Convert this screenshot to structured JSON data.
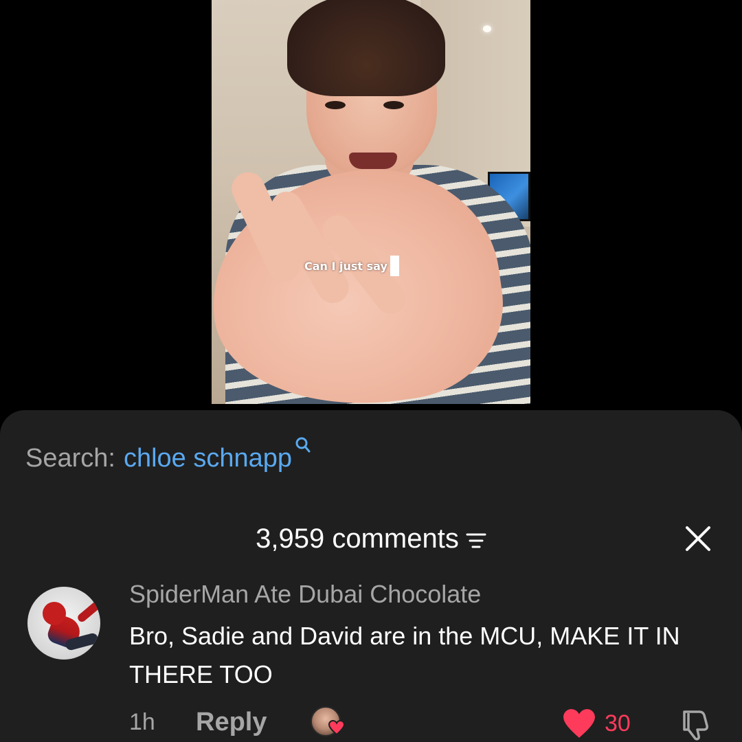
{
  "video": {
    "caption": "Can I just say"
  },
  "search": {
    "label": "Search:",
    "query": "chloe schnapp",
    "icon": "search-icon",
    "query_color": "#5aa9f0"
  },
  "comments_panel": {
    "count_label": "3,959 comments",
    "sort_icon": "sort-icon",
    "close_icon": "close-icon"
  },
  "comment": {
    "author": "SpiderMan Ate Dubai Chocolate",
    "text": "Bro, Sadie and David are in the MCU, MAKE IT IN THERE TOO",
    "time": "1h",
    "reply_label": "Reply",
    "creator_liked": true,
    "likes": "30",
    "like_color": "#ff3b5c",
    "icons": [
      "heart-icon",
      "dislike-icon",
      "creator-heart-icon"
    ]
  },
  "colors": {
    "background": "#000000",
    "sheet": "#1f1f1f",
    "muted_text": "#a6a6a6"
  }
}
